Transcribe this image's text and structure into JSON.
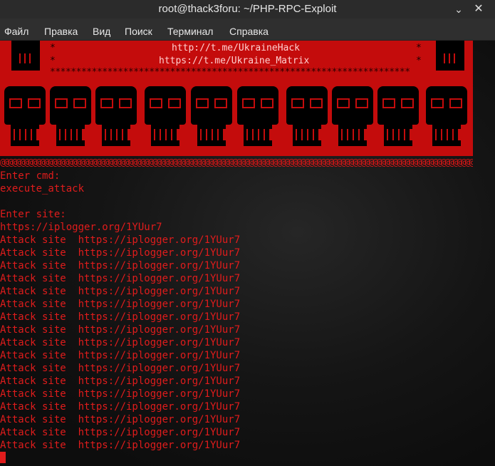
{
  "window": {
    "title": "root@thack3foru: ~/PHP-RPC-Exploit",
    "minimize_glyph": "⌄",
    "close_glyph": "✕"
  },
  "menu": [
    "Файл",
    "Правка",
    "Вид",
    "Поиск",
    "Терминал",
    "Справка"
  ],
  "banner": {
    "link1": "http://t.me/UkraineHack",
    "link2": "https://t.me/Ukraine_Matrix",
    "star": "*",
    "stars_row": "*********************************************************************",
    "at_row": "@@@@@@@@@@@@@@@@@@@@@@@@@@@@@@@@@@@@@@@@@@@@@@@@@@@@@@@@@@@@@@@@@@@@@@@@@@@@@@@@@@@@@@@@@@@@@@@@@@@@@@@@@@@@@@@@@@@@@@@@@@@@@@@@@",
    "accent_color": "#c40c0c"
  },
  "terminal": {
    "prompt_cmd": "Enter cmd:",
    "cmd": "execute_attack",
    "prompt_site": "Enter site:",
    "site": "https://iplogger.org/1YUur7",
    "attack_lines": [
      "Attack site  https://iplogger.org/1YUur7",
      "Attack site  https://iplogger.org/1YUur7",
      "Attack site  https://iplogger.org/1YUur7",
      "Attack site  https://iplogger.org/1YUur7",
      "Attack site  https://iplogger.org/1YUur7",
      "Attack site  https://iplogger.org/1YUur7",
      "Attack site  https://iplogger.org/1YUur7",
      "Attack site  https://iplogger.org/1YUur7",
      "Attack site  https://iplogger.org/1YUur7",
      "Attack site  https://iplogger.org/1YUur7",
      "Attack site  https://iplogger.org/1YUur7",
      "Attack site  https://iplogger.org/1YUur7",
      "Attack site  https://iplogger.org/1YUur7",
      "Attack site  https://iplogger.org/1YUur7",
      "Attack site  https://iplogger.org/1YUur7",
      "Attack site  https://iplogger.org/1YUur7",
      "Attack site  https://iplogger.org/1YUur7"
    ],
    "text_color": "#e01c1c"
  }
}
